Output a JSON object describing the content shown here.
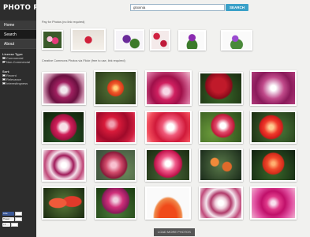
{
  "app": {
    "logo": "PHOTO PIN"
  },
  "nav": {
    "home": "Home",
    "search": "Search",
    "about": "About"
  },
  "filters": {
    "license_title": "License Type:",
    "license_options": [
      "Commercial",
      "Non-Commercial"
    ],
    "sort_title": "Sort:",
    "sort_options": [
      "Recent",
      "Relevance",
      "Interestingness"
    ]
  },
  "search": {
    "query": "gloxinia",
    "button": "SEARCH"
  },
  "sections": {
    "paid_label": "Pay for Photos (no link required)",
    "cc_label": "Creative Commons Photos via Flickr (free to use, link required)"
  },
  "social": {
    "like": "Like",
    "tweet": "Tweet",
    "plus": "+1"
  },
  "load_more": "LOAD MORE PHOTOS",
  "colors": {
    "sidebar": "#2d2d2d",
    "search_button": "#3aa0c8",
    "accent_magenta": "#b0105a",
    "accent_red": "#d82a2a"
  }
}
